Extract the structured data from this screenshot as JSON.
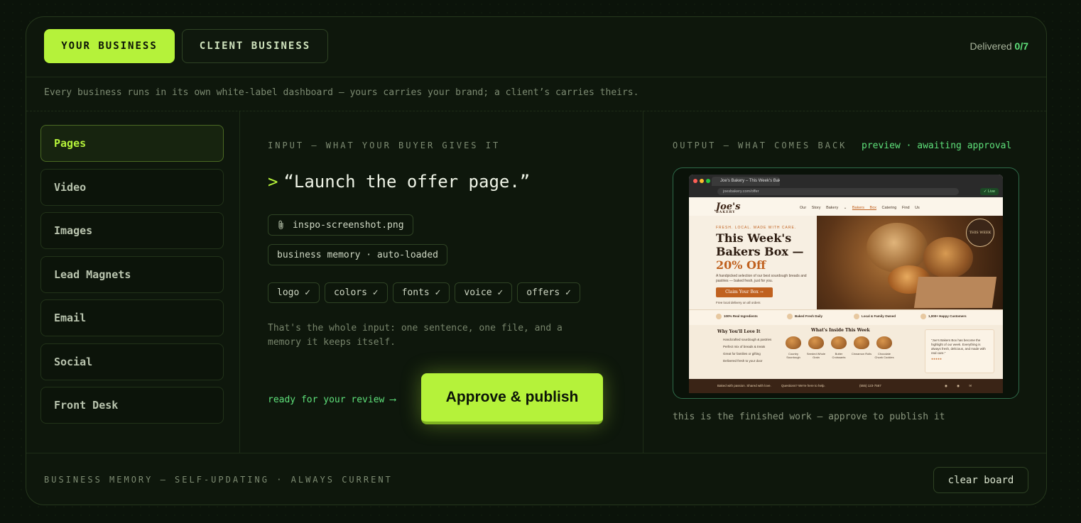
{
  "tabs": {
    "your_business": "YOUR BUSINESS",
    "client_business": "CLIENT BUSINESS"
  },
  "delivered": {
    "label": "Delivered",
    "count": "0/7"
  },
  "subtitle": "Every business runs in its own white-label dashboard — yours carries your brand; a client’s carries theirs.",
  "sidebar": {
    "items": [
      {
        "label": "Pages",
        "active": true
      },
      {
        "label": "Video"
      },
      {
        "label": "Images"
      },
      {
        "label": "Lead Magnets"
      },
      {
        "label": "Email"
      },
      {
        "label": "Social"
      },
      {
        "label": "Front Desk"
      }
    ]
  },
  "input": {
    "label": "INPUT — WHAT YOUR BUYER GIVES IT",
    "prompt_marker": ">",
    "prompt": "“Launch the offer page.”",
    "attachment": "inspo-screenshot.png",
    "memory_chip": "business memory · auto-loaded",
    "checks": [
      "logo ✓",
      "colors ✓",
      "fonts ✓",
      "voice ✓",
      "offers ✓"
    ],
    "description": "That's the whole input: one sentence, one file, and a memory it keeps itself.",
    "ready_text": "ready for your review ⟶",
    "approve_label": "Approve & publish"
  },
  "output": {
    "label": "OUTPUT — WHAT COMES BACK",
    "status": "preview · awaiting approval",
    "caption": "this is the finished work — approve to publish it",
    "preview": {
      "tab_title": "Joe's Bakery – This Week's Bakers Box",
      "url": "joesbakery.com/offer",
      "live": "✓ Live",
      "logo": "Joe's",
      "logo_sub": "BAKERY",
      "nav": [
        "Our Story",
        "Bakery ⌄",
        "Bakers Box",
        "Catering",
        "Find Us"
      ],
      "eyebrow": "FRESH. LOCAL. MADE WITH CARE.",
      "headline_line1": "This Week's",
      "headline_line2": "Bakers Box —",
      "headline_offer": "20% Off",
      "subtext": "A handpicked selection of our best sourdough breads and pastries — baked fresh, just for you.",
      "cta": "Claim Your Box →",
      "fineprint": "Free local delivery on all orders",
      "badge": "THIS WEEK",
      "features": [
        "100% Real Ingredients",
        "Baked Fresh Daily",
        "Local & Family Owned",
        "1,000+ Happy Customers"
      ],
      "why_title": "Why You'll Love It",
      "why_items": [
        "Handcrafted sourdough & pastries",
        "Perfect mix of breads & treats",
        "Great for families or gifting",
        "Delivered fresh to your door"
      ],
      "inside_title": "What's Inside This Week",
      "pastries": [
        "Country Sourdough",
        "Seeded Whole Grain",
        "Butter Croissants",
        "Cinnamon Rolls",
        "Chocolate Chunk Cookies"
      ],
      "testimonial": "“Joe's Bakers Box has become the highlight of our week. Everything is always fresh, delicious, and made with real care.”",
      "stars": "★★★★★",
      "footer_left": "Baked with passion. Shared with love.",
      "footer_mid": "Questions? We're here to help.",
      "footer_phone": "(555) 123-7567"
    }
  },
  "footer": {
    "memory": "BUSINESS MEMORY — SELF-UPDATING · ALWAYS CURRENT",
    "clear": "clear board"
  }
}
